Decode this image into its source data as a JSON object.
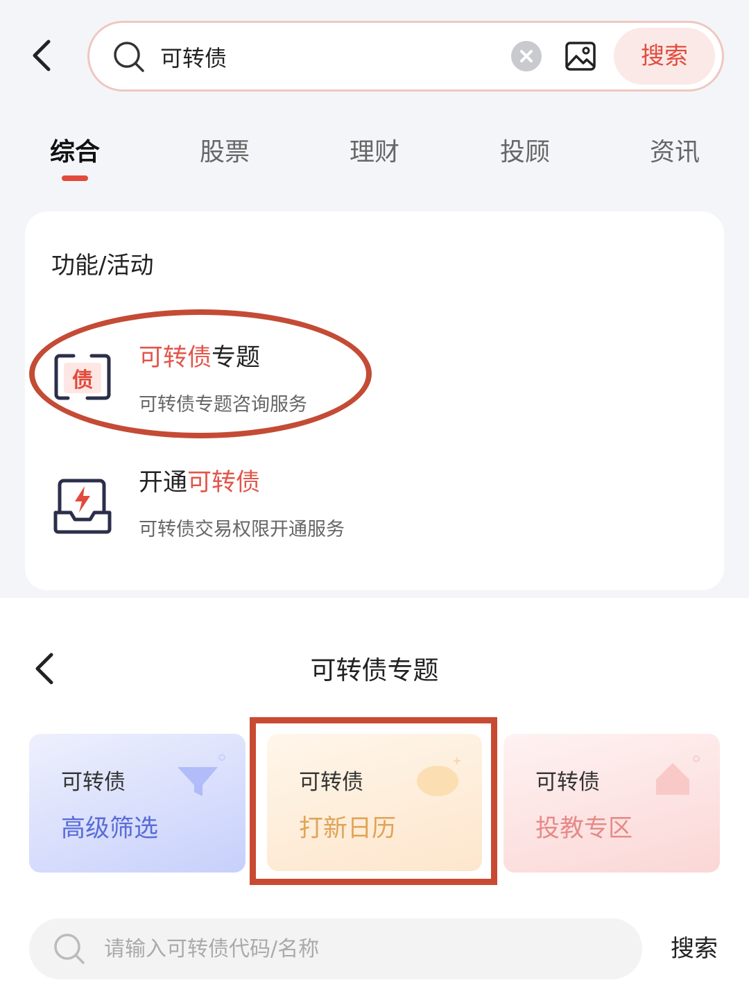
{
  "search": {
    "value": "可转债",
    "button_label": "搜索"
  },
  "tabs": [
    {
      "label": "综合"
    },
    {
      "label": "股票"
    },
    {
      "label": "理财"
    },
    {
      "label": "投顾"
    },
    {
      "label": "资讯"
    }
  ],
  "features": {
    "section_title": "功能/活动",
    "items": [
      {
        "title_highlight": "可转债",
        "title_rest": "专题",
        "subtitle": "可转债专题咨询服务",
        "icon": "bond-doc-icon"
      },
      {
        "title_prefix": "开通",
        "title_highlight": "可转债",
        "subtitle": "可转债交易权限开通服务",
        "icon": "lightning-tray-icon"
      }
    ]
  },
  "topic_page": {
    "title": "可转债专题",
    "tiles": [
      {
        "line1": "可转债",
        "line2": "高级筛选",
        "icon": "funnel-icon"
      },
      {
        "line1": "可转债",
        "line2": "打新日历",
        "icon": "calendar-icon"
      },
      {
        "line1": "可转债",
        "line2": "投教专区",
        "icon": "house-icon"
      }
    ],
    "search_placeholder": "请输入可转债代码/名称",
    "search_button": "搜索"
  },
  "colors": {
    "accent_red": "#e24a3b",
    "annotation_red": "#c44b35",
    "tile_blue": "#5a6cd6",
    "tile_orange": "#e0a456",
    "tile_pink": "#e58a88"
  }
}
